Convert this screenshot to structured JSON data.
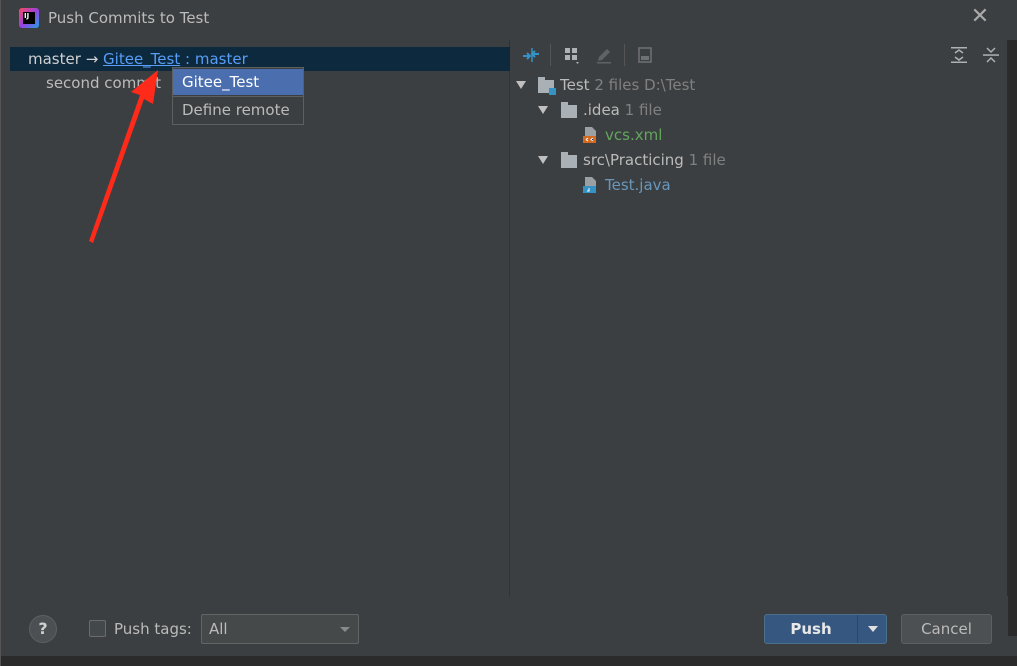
{
  "window": {
    "title": "Push Commits to Test",
    "app_icon_text": "IJ"
  },
  "left": {
    "branch": {
      "source": "master",
      "arrow": "→",
      "remote": "Gitee_Test",
      "separator": ":",
      "target": "master"
    },
    "commit": "second commit"
  },
  "popup": {
    "items": [
      {
        "label": "Gitee_Test"
      },
      {
        "label": "Define remote"
      }
    ]
  },
  "tree": {
    "root": {
      "name": "Test",
      "meta": "2 files  D:\\Test"
    },
    "idea": {
      "name": ".idea",
      "meta": "1 file"
    },
    "vcs": {
      "name": "vcs.xml"
    },
    "src": {
      "name": "src\\Practicing",
      "meta": "1 file"
    },
    "java": {
      "name": "Test.java"
    }
  },
  "footer": {
    "help": "?",
    "push_tags_label": "Push tags:",
    "push_tags_checked": false,
    "tags_select": "All",
    "push_label": "Push",
    "cancel_label": "Cancel"
  },
  "colors": {
    "accent": "#365880",
    "selection": "#4b6eaf",
    "link": "#589df6",
    "annotation_arrow": "#ff2a1a"
  },
  "icons": [
    "app-icon",
    "close-icon",
    "collapse-icon",
    "group-by-icon",
    "edit-icon",
    "show-diff-icon",
    "expand-all-icon",
    "collapse-all-icon",
    "folder-icon",
    "xml-file-icon",
    "java-file-icon",
    "help-icon",
    "chevron-down-icon"
  ]
}
